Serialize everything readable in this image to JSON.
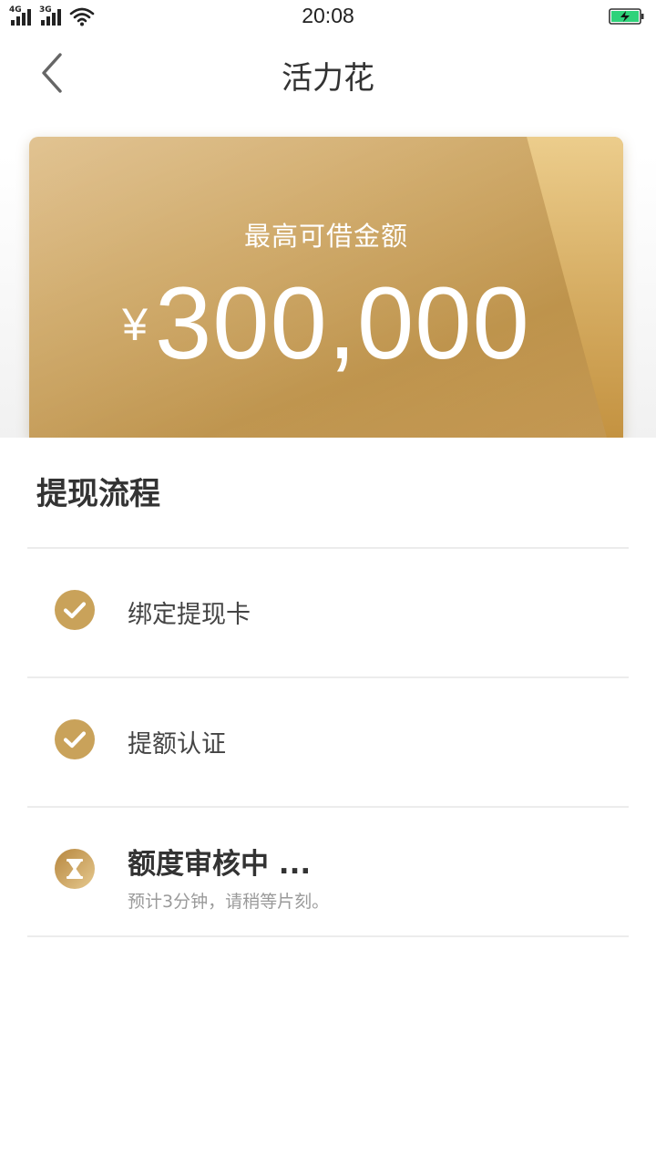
{
  "status_bar": {
    "time": "20:08",
    "signal_1_label": "4G",
    "signal_2_label": "3G"
  },
  "nav": {
    "title": "活力花"
  },
  "card": {
    "label": "最高可借金额",
    "currency": "¥",
    "amount": "300,000"
  },
  "process": {
    "title": "提现流程",
    "steps": [
      {
        "label": "绑定提现卡",
        "status": "done"
      },
      {
        "label": "提额认证",
        "status": "done"
      },
      {
        "label": "额度审核中 ...",
        "sub": "预计3分钟，请稍等片刻。",
        "status": "pending"
      }
    ]
  },
  "colors": {
    "gold": "#c9a25a",
    "gold_light": "#e8c88a",
    "battery_green": "#2fd27a"
  },
  "icons": {
    "back": "chevron-left-icon",
    "done": "check-circle-icon",
    "pending": "hourglass-icon"
  }
}
